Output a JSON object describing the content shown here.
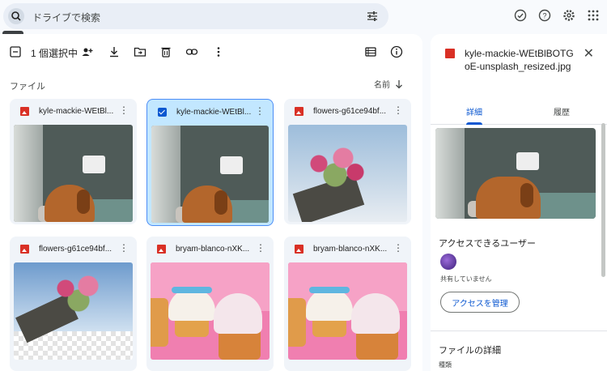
{
  "search": {
    "placeholder": "ドライブで検索",
    "tooltip": "検索"
  },
  "toolbar": {
    "selection_text": "1 個選択中"
  },
  "main": {
    "section_label": "ファイル",
    "sort_label": "名前"
  },
  "files": [
    {
      "name": "kyle-mackie-WEtBl...",
      "selected": false,
      "thumb": "dog"
    },
    {
      "name": "kyle-mackie-WEtBl...",
      "selected": true,
      "thumb": "dog"
    },
    {
      "name": "flowers-g61ce94bf...",
      "selected": false,
      "thumb": "flower1"
    },
    {
      "name": "flowers-g61ce94bf...",
      "selected": false,
      "thumb": "flower2"
    },
    {
      "name": "bryam-blanco-nXK...",
      "selected": false,
      "thumb": "cup"
    },
    {
      "name": "bryam-blanco-nXK...",
      "selected": false,
      "thumb": "cup"
    }
  ],
  "details": {
    "file_title": "kyle-mackie-WEtBlBOTGoE-unsplash_resized.jpg",
    "tab_details": "詳細",
    "tab_activity": "履歴",
    "access_heading": "アクセスできるユーザー",
    "share_status": "共有していません",
    "manage_access_label": "アクセスを管理",
    "file_details_heading": "ファイルの詳細",
    "type_label": "種類"
  },
  "colors": {
    "accent": "#0b57d0",
    "selected_bg": "#c2e7ff",
    "card_bg": "#f0f4f9",
    "page_bg": "#f8fafd",
    "image_icon": "#d93025"
  }
}
